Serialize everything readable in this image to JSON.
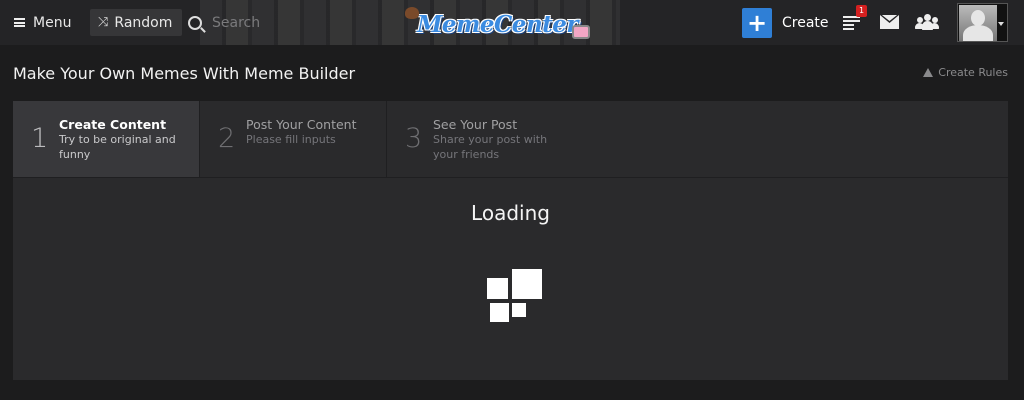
{
  "nav": {
    "menu_label": "Menu",
    "random_label": "Random",
    "search_placeholder": "Search",
    "logo_text": "MemeCenter",
    "create_label": "Create",
    "notifications_count": "1"
  },
  "page": {
    "title": "Make Your Own Memes With Meme Builder",
    "rules_label": "Create Rules"
  },
  "steps": [
    {
      "number": "1",
      "title": "Create Content",
      "desc": "Try to be original and funny",
      "active": true
    },
    {
      "number": "2",
      "title": "Post Your Content",
      "desc": "Please fill inputs",
      "active": false
    },
    {
      "number": "3",
      "title": "See Your Post",
      "desc": "Share your post with your friends",
      "active": false
    }
  ],
  "content": {
    "loading_text": "Loading"
  },
  "colors": {
    "accent_blue": "#2f7fd6",
    "badge_red": "#d42020",
    "background": "#1c1c1d",
    "panel": "#2a2a2c"
  },
  "icons": [
    "menu-icon",
    "shuffle-icon",
    "search-icon",
    "plus-icon",
    "feed-icon",
    "mail-icon",
    "group-icon",
    "warning-icon",
    "caret-down-icon"
  ]
}
